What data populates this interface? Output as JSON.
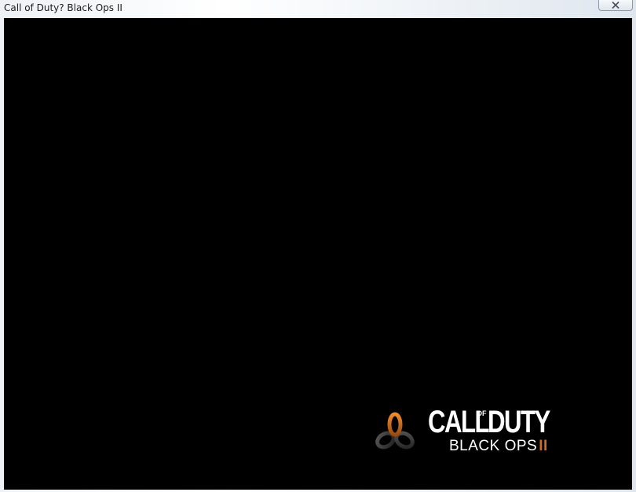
{
  "window": {
    "title": "Call of Duty? Black Ops II",
    "close_icon": "close-icon"
  },
  "game": {
    "background_color": "#000000",
    "logo": {
      "title_call": "CALL",
      "title_of": "OF",
      "title_duty": "DUTY",
      "subtitle": "BLACK OPS",
      "subtitle_numeral": "II",
      "accent_color": "#d36a1c",
      "emblem_icon": "black-ops-emblem-icon"
    }
  }
}
